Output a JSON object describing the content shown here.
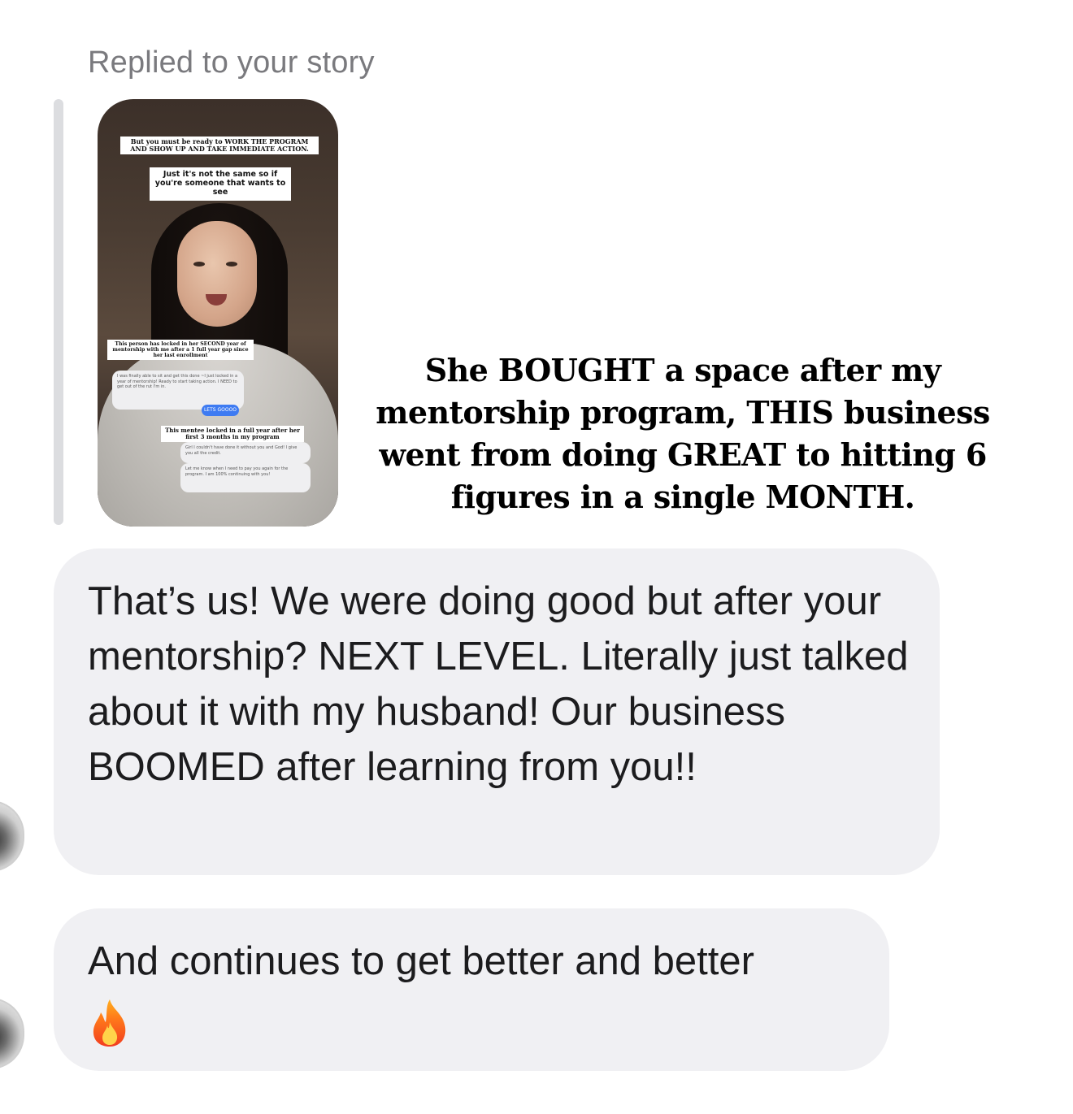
{
  "header": {
    "replied_label": "Replied to your story"
  },
  "story": {
    "caption_top": "But you must be ready to WORK THE PROGRAM AND SHOW UP AND TAKE IMMEDIATE ACTION.",
    "caption_box": "Just it's not the same so if you're someone that wants to see",
    "caption_mid": "This person has locked in her SECOND year of mentorship with me after a 1 full year gap since her last enrollment",
    "chat_1": "I was finally able to sit and get this done ~I just locked in a year of mentorship! Ready to start taking action. I NEED to get out of the rut I'm in.",
    "chat_button": "LETS GOOOO",
    "caption_bottom": "This mentee locked in a full year after her first 3 months in my program",
    "chat_2": "Girl I couldn't have done it without you and God! I give you all the credit.",
    "chat_3": "Let me know when I need to pay you again for the program. I am 100% continuing with you!"
  },
  "overlay_caption": "She BOUGHT a space after my mentorship program, THIS business went from doing GREAT to hitting 6 figures in a single MONTH.",
  "messages": [
    {
      "text": "That’s us! We were doing good but after your mentorship? NEXT LEVEL. Literally just talked about it with my husband! Our business BOOMED after learning from you!!"
    },
    {
      "text": "And continues to get better and better"
    }
  ],
  "colors": {
    "bubble_bg": "#f0f0f3",
    "muted_text": "#7a7a7e",
    "accent_blue": "#3e7bf2"
  },
  "icons": {
    "fire": "fire-emoji-icon",
    "avatar": "sender-avatar"
  }
}
